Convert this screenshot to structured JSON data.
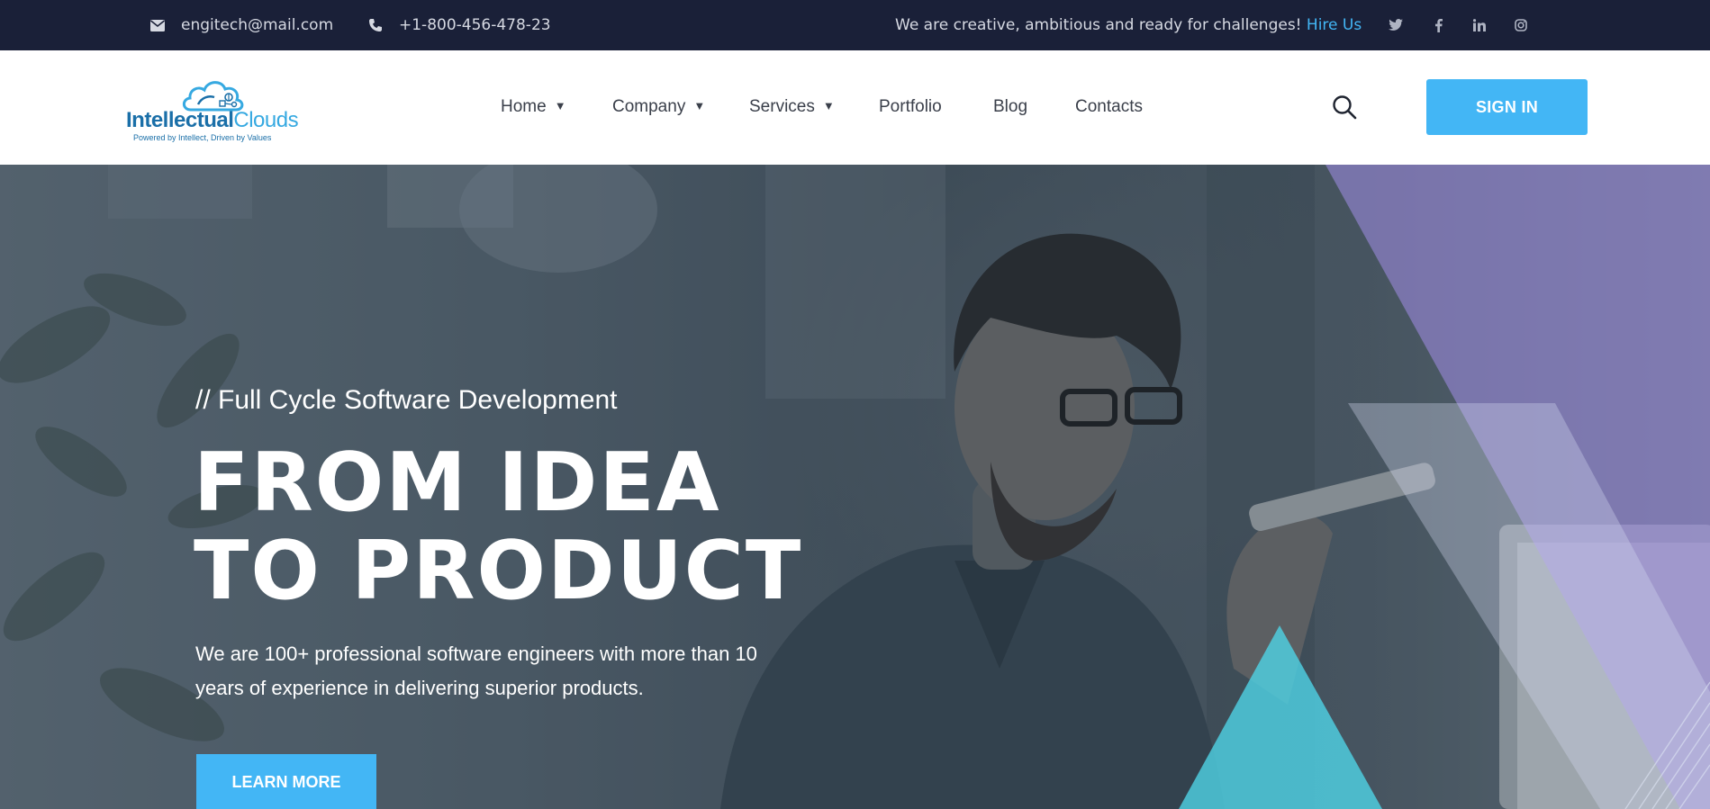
{
  "topbar": {
    "email": "engitech@mail.com",
    "phone": "+1-800-456-478-23",
    "tagline": "We are creative, ambitious and ready for challenges!",
    "hire_link": "Hire Us",
    "icons": [
      "envelope-icon",
      "phone-icon",
      "twitter-icon",
      "facebook-icon",
      "linkedin-icon",
      "instagram-icon"
    ]
  },
  "logo": {
    "part1": "Intellectual",
    "part2": "Clouds",
    "tagline": "Powered by Intellect, Driven by Values"
  },
  "nav": {
    "items": [
      {
        "label": "Home",
        "has_dropdown": true
      },
      {
        "label": "Company",
        "has_dropdown": true
      },
      {
        "label": "Services",
        "has_dropdown": true
      },
      {
        "label": "Portfolio",
        "has_dropdown": false
      },
      {
        "label": "Blog",
        "has_dropdown": false
      },
      {
        "label": "Contacts",
        "has_dropdown": false
      }
    ],
    "caret": "▼",
    "signin_label": "SIGN IN"
  },
  "hero": {
    "subtitle": "// Full Cycle Software Development",
    "title_line1": "FROM IDEA",
    "title_line2": "TO PRODUCT",
    "description": "We are 100+ professional software engineers with more than 10 years of experience in delivering superior products.",
    "cta_label": "LEARN MORE"
  },
  "colors": {
    "topbar_bg": "#1a2038",
    "accent": "#43b6f5",
    "logo_dark": "#1a6fa8",
    "logo_light": "#36a9e1",
    "purple_shape": "#a38ee8",
    "cyan_shape": "#4fd3e6"
  }
}
